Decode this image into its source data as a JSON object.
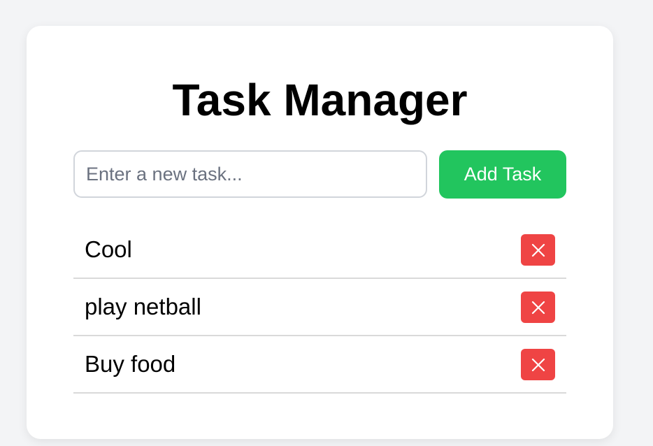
{
  "app": {
    "title": "Task Manager"
  },
  "input": {
    "placeholder": "Enter a new task...",
    "value": ""
  },
  "add_button": {
    "label": "Add Task"
  },
  "tasks": [
    {
      "text": "Cool",
      "delete_icon": "close-icon"
    },
    {
      "text": "play netball",
      "delete_icon": "close-icon"
    },
    {
      "text": "Buy food",
      "delete_icon": "close-icon"
    }
  ],
  "colors": {
    "page_background": "#f3f4f6",
    "card_background": "#ffffff",
    "add_button": "#22c55e",
    "delete_button": "#ef4444",
    "divider": "#d9d9d9"
  }
}
